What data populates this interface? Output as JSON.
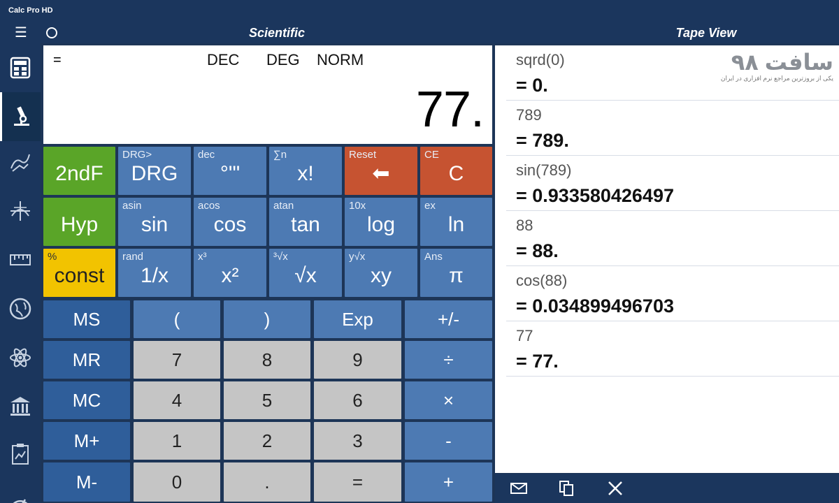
{
  "app": {
    "title": "Calc Pro HD"
  },
  "header": {
    "mode_title": "Scientific",
    "tape_title": "Tape View"
  },
  "display": {
    "equals": "=",
    "base": "DEC",
    "angle": "DEG",
    "format": "NORM",
    "value": "77."
  },
  "keys": {
    "row1": [
      {
        "sub": "",
        "main": "2ndF"
      },
      {
        "sub": "DRG>",
        "main": "DRG"
      },
      {
        "sub": "dec",
        "main": "°'\""
      },
      {
        "sub": "∑n",
        "main": "x!"
      },
      {
        "sub": "Reset",
        "main": "⬅"
      },
      {
        "sub": "CE",
        "main": "C"
      }
    ],
    "row2": [
      {
        "sub": "",
        "main": "Hyp"
      },
      {
        "sub": "asin",
        "main": "sin"
      },
      {
        "sub": "acos",
        "main": "cos"
      },
      {
        "sub": "atan",
        "main": "tan"
      },
      {
        "sub": "10x",
        "main": "log"
      },
      {
        "sub": "ex",
        "main": "ln"
      }
    ],
    "row3": [
      {
        "sub": "%",
        "main": "const"
      },
      {
        "sub": "rand",
        "main": "1/x"
      },
      {
        "sub": "x³",
        "main": "x²"
      },
      {
        "sub": "³√x",
        "main": "√x"
      },
      {
        "sub": "y√x",
        "main": "xy"
      },
      {
        "sub": "Ans",
        "main": "π"
      }
    ],
    "memory": [
      "MS",
      "MR",
      "MC",
      "M+",
      "M-"
    ],
    "numpad": [
      [
        "(",
        ")",
        "Exp",
        "+/-"
      ],
      [
        "7",
        "8",
        "9",
        "÷"
      ],
      [
        "4",
        "5",
        "6",
        "×"
      ],
      [
        "1",
        "2",
        "3",
        "-"
      ],
      [
        "0",
        ".",
        "=",
        "+"
      ]
    ]
  },
  "tape": [
    {
      "expr": "sqrd(0)",
      "result": "= 0."
    },
    {
      "expr": "789",
      "result": "= 789."
    },
    {
      "expr": "sin(789)",
      "result": "= 0.933580426497"
    },
    {
      "expr": "88",
      "result": "= 88."
    },
    {
      "expr": "cos(88)",
      "result": "= 0.034899496703"
    },
    {
      "expr": "77",
      "result": "= 77."
    }
  ],
  "watermark": {
    "logo": "سافت ۹۸",
    "tagline": "یکی از بروزترین مراجع نرم افزاری در ایران"
  },
  "sidebar_icons": [
    "calculator-icon",
    "microscope-icon",
    "graph-hand-icon",
    "grid-globe-icon",
    "ruler-icon",
    "globe-icon",
    "atom-icon",
    "bank-icon",
    "clipboard-chart-icon",
    "gauge-icon"
  ],
  "colors": {
    "accent_blue": "#4d7ab3",
    "green": "#5aa528",
    "yellow": "#f2c300",
    "red": "#c65331",
    "dark_bg": "#1b365d"
  }
}
